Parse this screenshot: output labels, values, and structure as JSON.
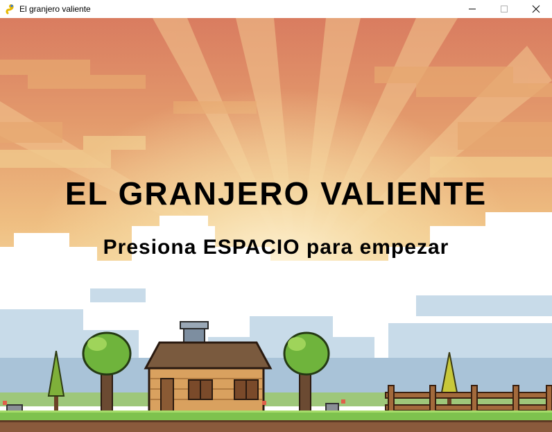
{
  "window": {
    "title": "El granjero valiente",
    "app_icon": "pygame-snake-icon",
    "controls": [
      "minimize-icon",
      "maximize-icon",
      "close-icon"
    ]
  },
  "game": {
    "title": "EL GRANJERO VALIENTE",
    "prompt": "Presiona ESPACIO para empezar"
  },
  "colors": {
    "sky_top": "#d97a5c",
    "sky_mid": "#eaa071",
    "sky_glow": "#f5d49a",
    "cloud": "#ffffff",
    "cloud_shade": "#c9dbe9",
    "grass": "#6fb84a",
    "soil": "#8a5a3c",
    "text": "#000000"
  }
}
